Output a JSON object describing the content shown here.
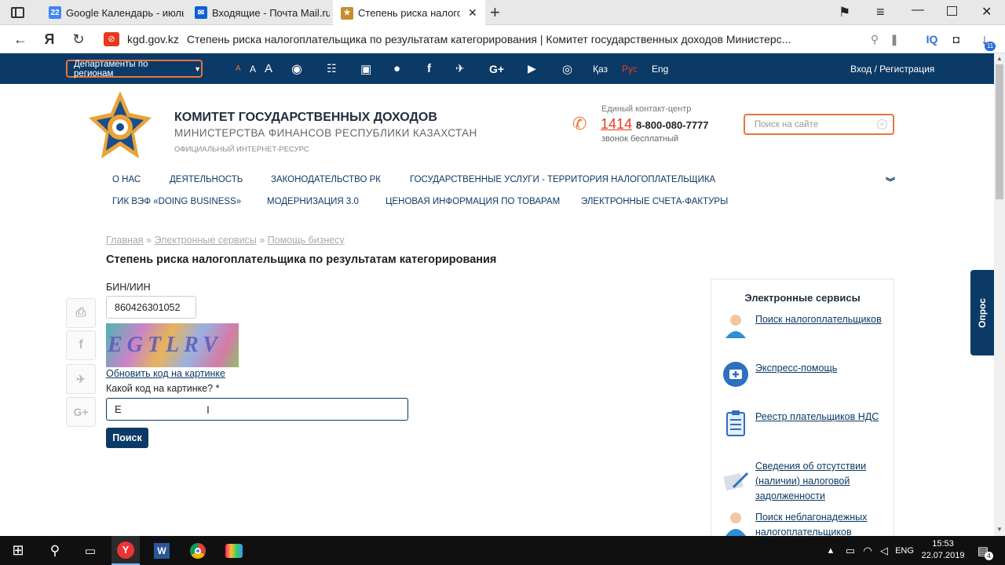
{
  "browser": {
    "tabs": [
      {
        "label": "Google Календарь - июль",
        "favicon": "22"
      },
      {
        "label": "Входящие - Почта Mail.ru",
        "favicon": "✉"
      },
      {
        "label": "Степень риска налогоп",
        "favicon": "★"
      }
    ],
    "new_tab_label": "+",
    "address": {
      "domain": "kgd.gov.kz",
      "title": "Степень риска налогоплательщика по результатам категорирования | Комитет государственных доходов Министерс..."
    },
    "iq_label": "IQ",
    "downloads_badge": "11"
  },
  "topstrip": {
    "dept_label": "Департаменты по регионам",
    "font_sizes": [
      "A",
      "A",
      "A"
    ],
    "lang_kaz": "Қаз",
    "lang_rus": "Рус",
    "lang_eng": "Eng",
    "login": "Вход / Регистрация"
  },
  "header": {
    "org_title": "КОМИТЕТ ГОСУДАРСТВЕННЫХ ДОХОДОВ",
    "org_subtitle": "МИНИСТЕРСТВА ФИНАНСОВ РЕСПУБЛИКИ КАЗАХСТАН",
    "org_note": "ОФИЦИАЛЬНЫЙ ИНТЕРНЕТ-РЕСУРС",
    "contact_label": "Единый контакт-центр",
    "contact_short": "1414",
    "contact_phone": "8-800-080-7777",
    "contact_free": "звонок бесплатный",
    "search_placeholder": "Поиск на сайте"
  },
  "menu": {
    "row1": [
      "О НАС",
      "ДЕЯТЕЛЬНОСТЬ",
      "ЗАКОНОДАТЕЛЬСТВО РК",
      "ГОСУДАРСТВЕННЫЕ УСЛУГИ - ТЕРРИТОРИЯ НАЛОГОПЛАТЕЛЬЩИКА"
    ],
    "row2": [
      "ГИК ВЭФ «DOING BUSINESS»",
      "МОДЕРНИЗАЦИЯ 3.0",
      "ЦЕНОВАЯ ИНФОРМАЦИЯ ПО ТОВАРАМ",
      "ЭЛЕКТРОННЫЕ СЧЕТА-ФАКТУРЫ"
    ]
  },
  "breadcrumb": [
    "Главная",
    "Электронные сервисы",
    "Помощь бизнесу"
  ],
  "breadcrumb_sep": "»",
  "page_title": "Степень риска налогоплательщика по результатам категорирования",
  "form": {
    "bin_label": "БИН/ИИН",
    "bin_value": "860426301052",
    "captcha_text": "EGTLRV",
    "refresh_label": "Обновить код на картинке",
    "code_label": "Какой код на картинке? *",
    "code_value": "E",
    "submit_label": "Поиск"
  },
  "sidebar": {
    "title": "Электронные сервисы",
    "items": [
      {
        "label": "Поиск налогоплательщиков"
      },
      {
        "label": "Экспресс-помощь"
      },
      {
        "label": "Реестр плательщиков НДС"
      },
      {
        "label": "Сведения об отсутствии (наличии) налоговой задолженности"
      },
      {
        "label": "Поиск неблагонадежных налогоплательщиков"
      }
    ]
  },
  "poll_tab": "Опрос",
  "taskbar": {
    "lang": "ENG",
    "time": "15:53",
    "date": "22.07.2019",
    "notif_count": "4"
  },
  "colors": {
    "brand_blue": "#0c3a66",
    "accent_orange": "#e8743b",
    "accent_red": "#e8391d"
  }
}
